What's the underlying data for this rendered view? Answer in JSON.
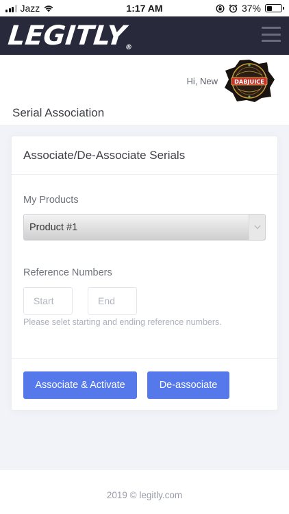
{
  "status_bar": {
    "carrier": "Jazz",
    "time": "1:17 AM",
    "battery_percent": "37%",
    "battery_level": 0.37,
    "icons": [
      "signal-icon",
      "wifi-icon",
      "rotation-lock-icon",
      "alarm-icon",
      "battery-icon"
    ]
  },
  "header": {
    "logo_text": "LEGITLY",
    "logo_mark": "®",
    "menu_icon": "hamburger-menu-icon",
    "background": "#282a3c"
  },
  "user": {
    "greeting": "Hi,",
    "name": "New",
    "avatar_brand": "DABJUICE",
    "avatar_ring_text": "PREMIUM WAX LIQUID"
  },
  "page": {
    "title": "Serial Association"
  },
  "card": {
    "title": "Associate/De-Associate Serials",
    "products_label": "My Products",
    "selected_product": "Product #1",
    "ref_label": "Reference Numbers",
    "start_placeholder": "Start",
    "end_placeholder": "End",
    "help_text": "Please selet starting and ending reference numbers.",
    "associate_button": "Associate & Activate",
    "deassociate_button": "De-associate"
  },
  "footer": {
    "text": "2019 © legitly.com"
  },
  "colors": {
    "primary_button": "#5578eb",
    "page_background": "#f2f3f8",
    "header_background": "#282a3c"
  }
}
